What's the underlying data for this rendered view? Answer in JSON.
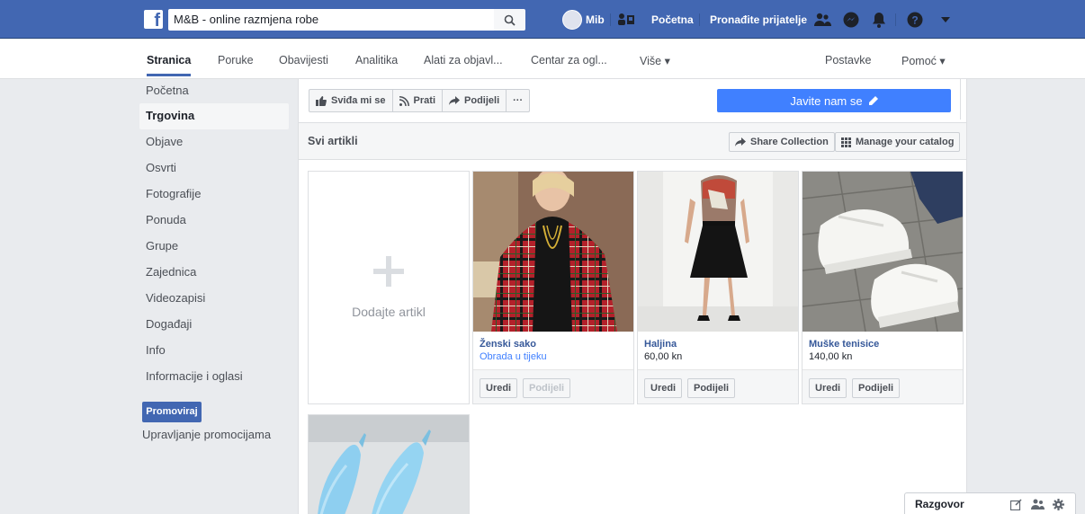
{
  "topbar": {
    "logo": "f",
    "search_value": "M&B - online razmjena robe",
    "user_name": "Mib",
    "home_label": "Početna",
    "find_friends_label": "Pronađite prijatelje"
  },
  "tabs": [
    "Stranica",
    "Poruke",
    "Obavijesti",
    "Analitika",
    "Alati za objavl...",
    "Centar za ogl...",
    "Više ▾",
    "Postavke",
    "Pomoć ▾"
  ],
  "sidebar": {
    "items": [
      "Početna",
      "Trgovina",
      "Objave",
      "Osvrti",
      "Fotografije",
      "Ponuda",
      "Grupe",
      "Zajednica",
      "Videozapisi",
      "Događaji",
      "Info",
      "Informacije i oglasi"
    ],
    "active": "Trgovina",
    "promote_button": "Promoviraj",
    "manage_promotions": "Upravljanje promocijama"
  },
  "actions": {
    "like": "Sviđa mi se",
    "follow": "Prati",
    "share": "Podijeli",
    "more": "···",
    "contact": "Javite nam se"
  },
  "catalog": {
    "title": "Svi artikli",
    "share_collection": "Share Collection",
    "manage_catalog": "Manage your catalog",
    "add_item": "Dodajte artikl",
    "products": [
      {
        "name": "Ženski sako",
        "price": "Obrada u tijeku",
        "edit": "Uredi",
        "share": "Podijeli",
        "share_disabled": true
      },
      {
        "name": "Haljina",
        "price": "60,00 kn",
        "edit": "Uredi",
        "share": "Podijeli",
        "share_disabled": false
      },
      {
        "name": "Muške tenisice",
        "price": "140,00 kn",
        "edit": "Uredi",
        "share": "Podijeli",
        "share_disabled": false
      }
    ]
  },
  "chat": {
    "label": "Razgovor"
  },
  "colors": {
    "brand": "#4267b2",
    "accent": "#4080ff",
    "link": "#365899"
  }
}
